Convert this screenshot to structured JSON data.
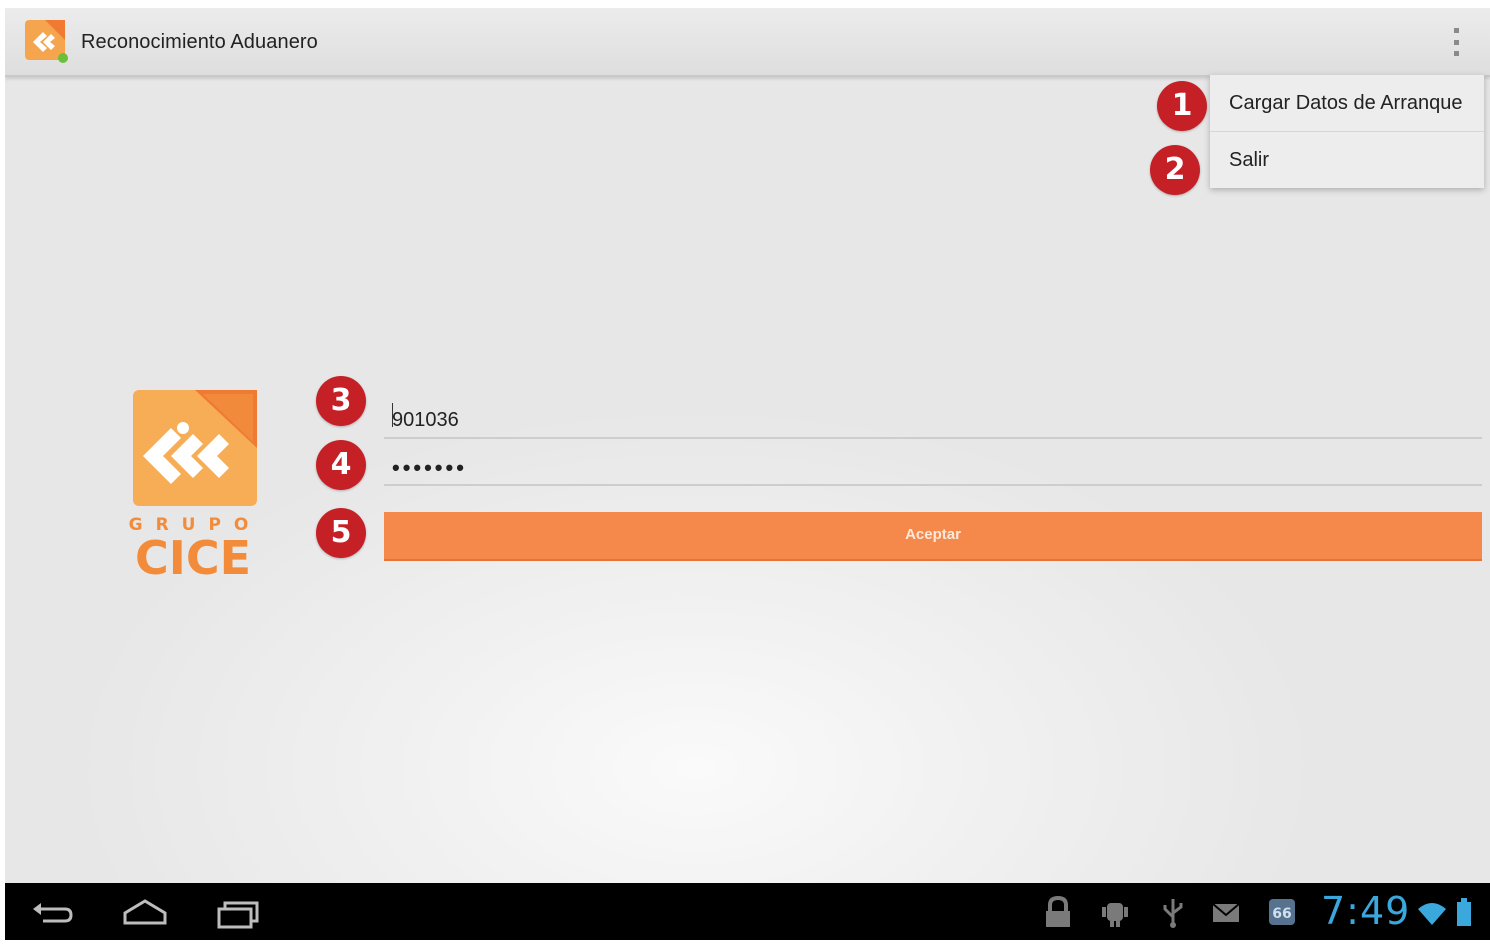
{
  "app_bar": {
    "title": "Reconocimiento Aduanero",
    "app_icon": "grupo-cice-app-icon",
    "overflow_icon": "overflow-menu-icon"
  },
  "overflow_menu": {
    "items": [
      {
        "label": "Cargar Datos de Arranque",
        "badge": "1"
      },
      {
        "label": "Salir",
        "badge": "2"
      }
    ]
  },
  "login_form": {
    "user": {
      "value": "901036",
      "badge": "3"
    },
    "password": {
      "value": "•••••••",
      "badge": "4"
    },
    "accept": {
      "label": "Aceptar",
      "badge": "5"
    }
  },
  "logo": {
    "text_top": "GRUPO",
    "text_bottom": "CICE"
  },
  "system_bar": {
    "clock": "7:49",
    "nav_icons": [
      "back-icon",
      "home-icon",
      "recents-icon"
    ],
    "status_icons": [
      "lock-icon",
      "android-debug-icon",
      "usb-icon",
      "email-icon",
      "app-notification-icon",
      "wifi-icon",
      "battery-icon"
    ]
  },
  "colors": {
    "accent_orange": "#f4894b",
    "logo_orange": "#f28c3b",
    "badge_red": "#c62027",
    "clock_blue": "#3aa7dd"
  }
}
